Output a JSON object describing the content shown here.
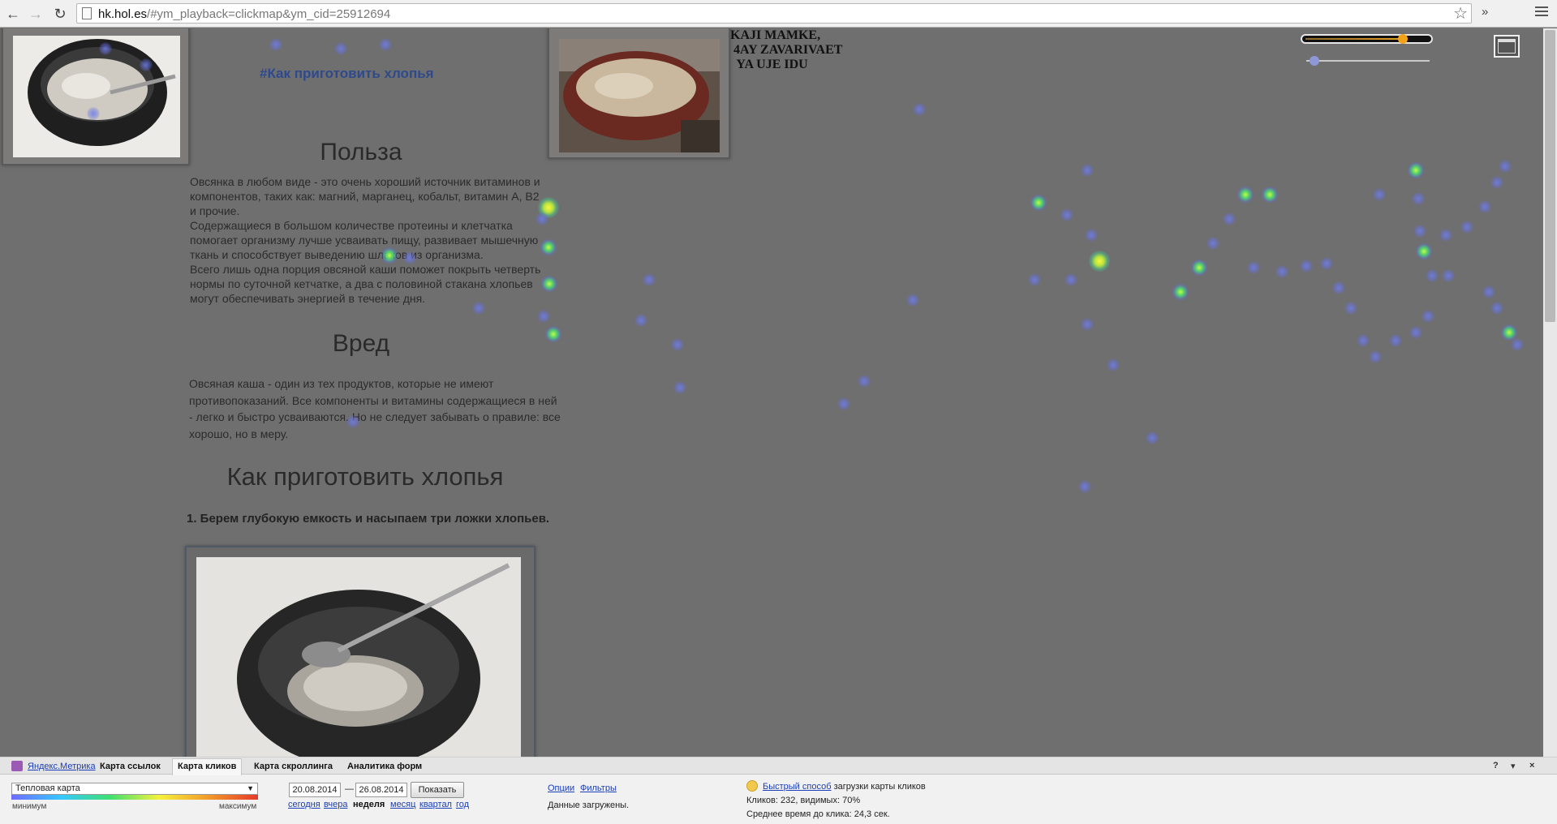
{
  "browser": {
    "url_host": "hk.hol.es",
    "url_rest": "/#ym_playback=clickmap&ym_cid=25912694",
    "ext_label": "»"
  },
  "page": {
    "hashtag": "#Как приготовить хлопья",
    "kaji_text": "KAJI MAMKE,\n 4AY ZAVARIVAET\n  YA UJE IDU",
    "sections": {
      "benefit_title": "Польза",
      "benefit_p1": "Овсянка в любом виде - это очень хороший источник витаминов и компонентов, таких как: магний, марганец, кобальт, витамин А, В2 и прочие.",
      "benefit_p2": "Содержащиеся в большом количестве протеины  и клетчатка помогает организму лучше усваивать пищу, развивает мышечную ткань и способствует выведению шлаков из организма.",
      "benefit_p3": "Всего лишь одна порция овсяной каши поможет покрыть четверть нормы по суточной кетчатке, а два с половиной стакана хлопьев могут обеспечивать энергией в течение дня.",
      "harm_title": "Вред",
      "harm_p1": "Овсяная каша - один из тех продуктов, которые не имеют противопоказаний. Все компоненты и витамины содержащиеся в ней - легко и быстро усваиваются.  Но не следует забывать о правиле: все хорошо, но в меру.",
      "howto_title": "Как приготовить хлопья",
      "step1": "1. Берем глубокую емкость и насыпаем три ложки хлопьев."
    }
  },
  "panel": {
    "logo_label": "Яндекс.Метрика",
    "tabs": [
      "Карта ссылок",
      "Карта кликов",
      "Карта скроллинга",
      "Аналитика форм"
    ],
    "active_tab": "Карта кликов",
    "controls": [
      "?",
      "▾",
      "×"
    ],
    "map_type": "Тепловая карта",
    "min_label": "минимум",
    "max_label": "максимум",
    "date_from": "20.08.2014",
    "date_sep": "—",
    "date_to": "26.08.2014",
    "show_btn": "Показать",
    "periods": [
      "сегодня",
      "вчера",
      "неделя",
      "месяц",
      "квартал",
      "год"
    ],
    "selected_period": "неделя",
    "options_link": "Опции",
    "filters_link": "Фильтры",
    "status": "Данные загружены.",
    "fast_link": "Быстрый способ",
    "fast_text": "загрузки карты кликов",
    "clicks": "Кликов: 232, видимых: 70%",
    "avg_time": "Среднее время до клика: 24,3 сек."
  },
  "colors": {
    "overlay": "#6f6f6f",
    "link": "#1a3fb8",
    "hashtag": "#2f4a8c",
    "slider_accent": "#f2a21a"
  }
}
